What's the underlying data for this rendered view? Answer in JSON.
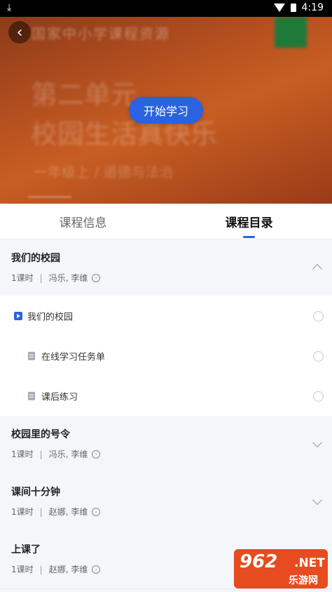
{
  "status_bar": {
    "time": "4:19"
  },
  "hero": {
    "blurred_title": "国家中小学课程资源",
    "blurred_unit": "第二单元",
    "blurred_lesson": "校园生活真快乐",
    "blurred_meta": "一年级上 / 道德与法治",
    "start_label": "开始学习"
  },
  "tabs": [
    {
      "label": "课程信息",
      "active": false
    },
    {
      "label": "课程目录",
      "active": true
    }
  ],
  "sections": [
    {
      "title": "我们的校园",
      "period": "1课时",
      "teachers": "冯乐, 李维",
      "expanded": true,
      "items": [
        {
          "label": "我们的校园",
          "type": "video"
        },
        {
          "label": "在线学习任务单",
          "type": "document"
        },
        {
          "label": "课后练习",
          "type": "document"
        }
      ]
    },
    {
      "title": "校园里的号令",
      "period": "1课时",
      "teachers": "冯乐, 李维",
      "expanded": false
    },
    {
      "title": "课间十分钟",
      "period": "1课时",
      "teachers": "赵娜, 李维",
      "expanded": false
    },
    {
      "title": "上课了",
      "period": "1课时",
      "teachers": "赵娜, 李维",
      "expanded": false
    }
  ],
  "watermark": {
    "number": "962",
    "net": ".NET",
    "site": "乐游网"
  },
  "colors": {
    "accent": "#2a62e0",
    "hero": "#b5501f"
  }
}
